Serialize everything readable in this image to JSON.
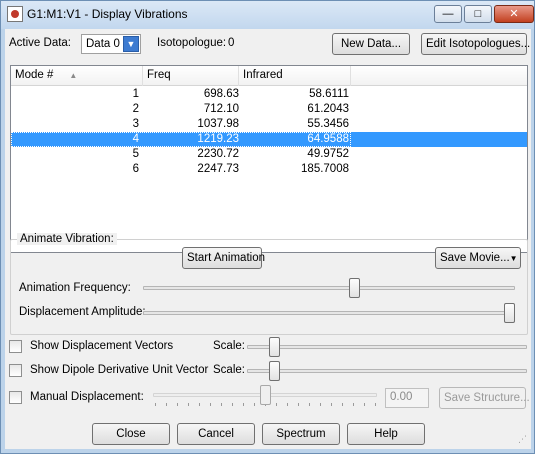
{
  "window": {
    "title": "G1:M1:V1 - Display Vibrations",
    "min_icon": "minimize-icon",
    "max_icon": "maximize-icon",
    "close_icon": "close-icon"
  },
  "top": {
    "active_data_label": "Active Data:",
    "active_data_value": "Data 0",
    "isotopologue_label": "Isotopologue:",
    "isotopologue_value": "0",
    "new_data_button": "New Data...",
    "edit_isotopologues_button": "Edit Isotopologues..."
  },
  "table": {
    "columns": [
      "Mode #",
      "Freq",
      "Infrared"
    ],
    "rows": [
      {
        "mode": "1",
        "freq": "698.63",
        "ir": "58.6111"
      },
      {
        "mode": "2",
        "freq": "712.10",
        "ir": "61.2043"
      },
      {
        "mode": "3",
        "freq": "1037.98",
        "ir": "55.3456"
      },
      {
        "mode": "4",
        "freq": "1219.23",
        "ir": "64.9588"
      },
      {
        "mode": "5",
        "freq": "2230.72",
        "ir": "49.9752"
      },
      {
        "mode": "6",
        "freq": "2247.73",
        "ir": "185.7008"
      }
    ],
    "selected_row_index": 3
  },
  "animate": {
    "group_title": "Animate Vibration:",
    "start_button": "Start Animation",
    "save_movie_button": "Save Movie...",
    "frequency_label": "Animation Frequency:",
    "frequency_level": 0.57,
    "amplitude_label": "Displacement Amplitude:",
    "amplitude_level": 1.0
  },
  "options": {
    "show_vectors_label": "Show Displacement Vectors",
    "show_vectors_checked": false,
    "show_dipole_label": "Show Dipole Derivative Unit Vector",
    "show_dipole_checked": false,
    "scale_label": "Scale:",
    "vector_scale_level": 0.08,
    "dipole_scale_level": 0.08,
    "manual_label": "Manual Displacement:",
    "manual_checked": false,
    "manual_level": 0.5,
    "manual_value": "0.00",
    "save_structure_button": "Save Structure..."
  },
  "buttons": {
    "close": "Close",
    "cancel": "Cancel",
    "spectrum": "Spectrum",
    "help": "Help"
  }
}
